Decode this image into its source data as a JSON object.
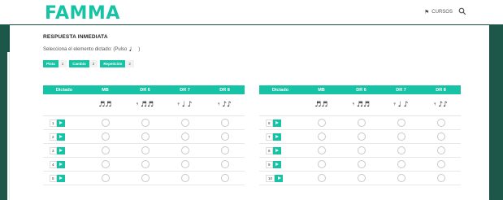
{
  "header": {
    "logo": "FAMMA",
    "nav_cursos": "CURSOS",
    "nav_cursos_icon": "flag-icon",
    "search_icon": "search-icon"
  },
  "page": {
    "title": "RESPUESTA INMEDIATA",
    "subtitle_prefix": "Selecciona el elemento dictado: (Pulso",
    "subtitle_note": "♩",
    "subtitle_suffix": ")"
  },
  "badges": [
    {
      "label": "Pista",
      "count": "1"
    },
    {
      "label": "Cambio",
      "count": "2"
    },
    {
      "label": "Repetición",
      "count": "2"
    }
  ],
  "table": {
    "headers": [
      "Dictado",
      "MB",
      "DR 6",
      "DR 7",
      "DR 8"
    ],
    "rhythms": [
      "♬♬",
      "𝄾 ♬♬",
      "𝄾 ♩ ♪",
      "𝄾 ♪♪"
    ],
    "left_rows": [
      "1",
      "2",
      "3",
      "4",
      "5"
    ],
    "right_rows": [
      "6",
      "7",
      "8",
      "9",
      "10"
    ]
  },
  "colors": {
    "accent": "#17c3a5",
    "band": "#1d5749"
  }
}
